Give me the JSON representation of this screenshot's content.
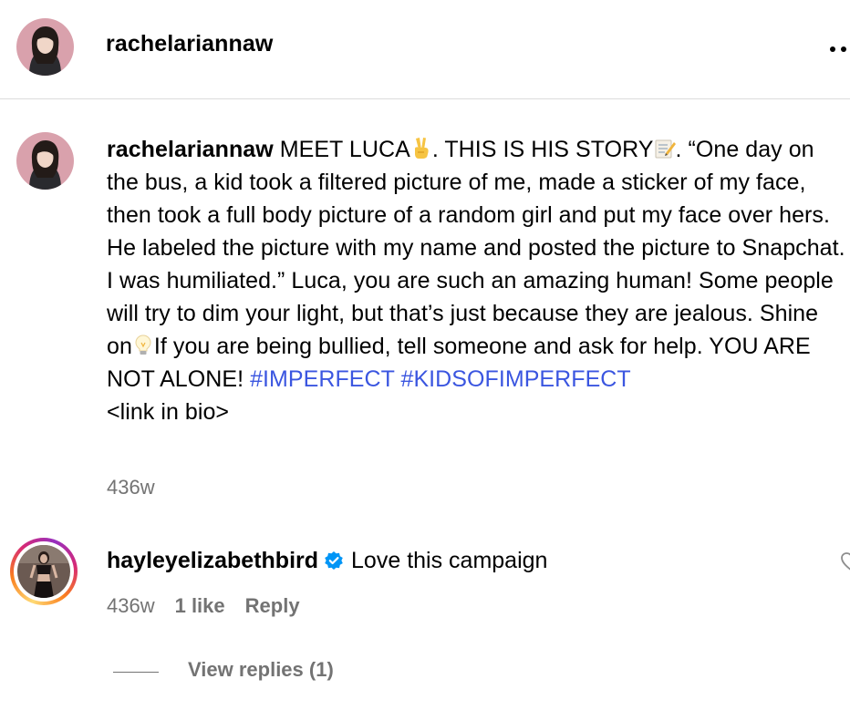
{
  "header": {
    "username": "rachelariannaw"
  },
  "caption": {
    "username": "rachelariannaw",
    "segment1": " MEET LUCA",
    "segment2": ". THIS IS HIS STORY",
    "segment3": ". “One day on the bus, a kid took a filtered picture of me, made a sticker of my face, then took a full body picture of a random girl and put my face over hers. He labeled the picture with my name and posted the picture to Snapchat. I was humiliated.” Luca, you are such an amazing human! Some people will try to dim your light, but that’s just because they are jealous. Shine on",
    "segment4": "If you are being bullied, tell someone and ask for help. YOU ARE NOT ALONE! ",
    "hashtag1": "#IMPERFECT",
    "hashtag2": "#KIDSOFIMPERFECT",
    "segment5": "<link in bio>",
    "emojis": [
      "victory-hand-icon",
      "memo-icon",
      "light-bulb-icon"
    ],
    "time": "436w"
  },
  "comment": {
    "username": "hayleyelizabethbird",
    "verified": true,
    "text": "Love this campaign",
    "time": "436w",
    "likes": "1 like",
    "reply_label": "Reply"
  },
  "replies": {
    "label": "View replies (1)"
  },
  "colors": {
    "hashtag": "#3b56e0",
    "secondary_text": "#737373",
    "verified": "#0095f6",
    "divider": "#dbdbdb"
  }
}
